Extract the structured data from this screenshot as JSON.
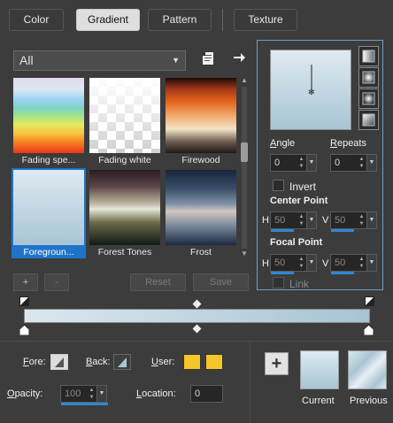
{
  "tabs": [
    {
      "label": "Color",
      "active": false
    },
    {
      "label": "Gradient",
      "active": true
    },
    {
      "label": "Pattern",
      "active": false
    },
    {
      "label": "Texture",
      "active": false
    }
  ],
  "library": {
    "filter": "All",
    "items": [
      {
        "name": "Fading spe...",
        "selected": false
      },
      {
        "name": "Fading white",
        "selected": false
      },
      {
        "name": "Firewood",
        "selected": false
      },
      {
        "name": "Foregroun...",
        "selected": true
      },
      {
        "name": "Forest Tones",
        "selected": false
      },
      {
        "name": "Frost",
        "selected": false
      }
    ],
    "add_label": "+",
    "remove_label": "-",
    "reset_label": "Reset",
    "save_label": "Save"
  },
  "style": {
    "angle_label": "Angle",
    "angle_value": "0",
    "repeats_label": "Repeats",
    "repeats_value": "0",
    "invert_label": "Invert",
    "center_point_label": "Center Point",
    "center_h_label": "H",
    "center_h_value": "50",
    "center_v_label": "V",
    "center_v_value": "50",
    "focal_point_label": "Focal Point",
    "focal_h_label": "H",
    "focal_h_value": "50",
    "focal_v_label": "V",
    "focal_v_value": "50",
    "link_label": "Link"
  },
  "editor": {
    "fore_label": "Fore:",
    "back_label": "Back:",
    "user_label": "User:",
    "user_color": "#f5c52a",
    "opacity_label": "Opacity:",
    "opacity_value": "100",
    "location_label": "Location:",
    "location_value": "0"
  },
  "bottom": {
    "add_icon": "+",
    "current_label": "Current",
    "previous_label": "Previous"
  },
  "colors": {
    "accent": "#1f73c9",
    "panel_border": "#6e9cc2",
    "gradient_start": "#dbe7ee",
    "gradient_end": "#a7c3d3"
  }
}
